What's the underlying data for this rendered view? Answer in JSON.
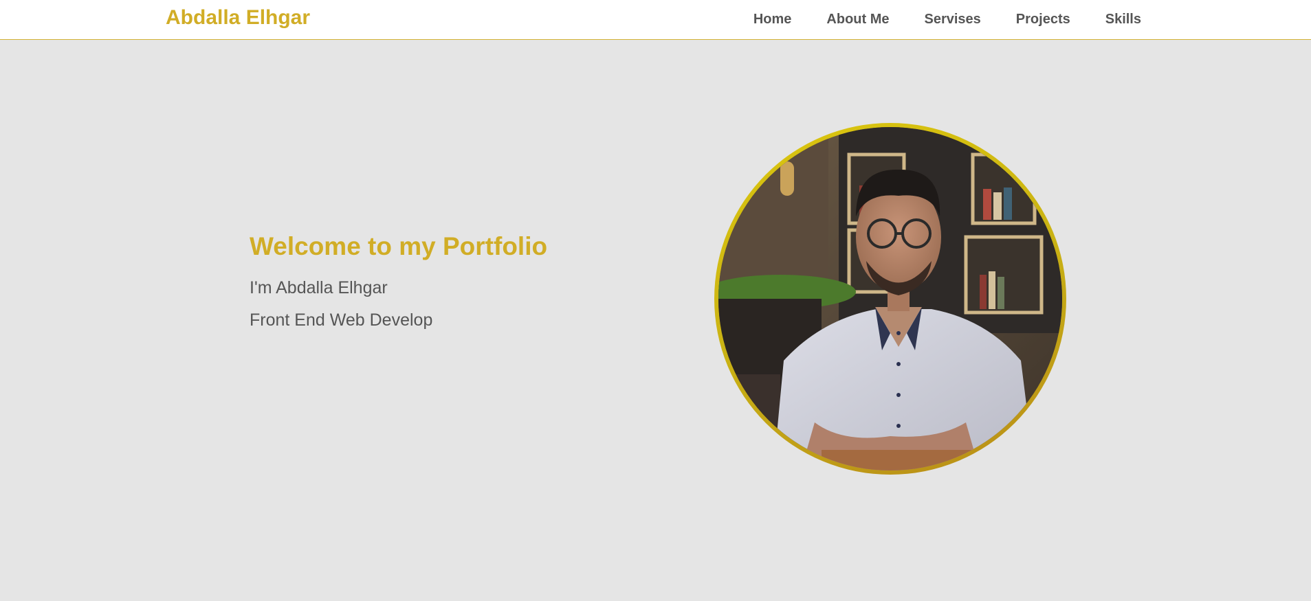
{
  "header": {
    "logo": "Abdalla Elhgar",
    "nav": [
      {
        "label": "Home"
      },
      {
        "label": "About Me"
      },
      {
        "label": "Servises"
      },
      {
        "label": "Projects"
      },
      {
        "label": "Skills"
      }
    ]
  },
  "hero": {
    "title": "Welcome to my Portfolio",
    "name_line": "I'm Abdalla Elhgar",
    "role_line": "Front End Web Develop"
  },
  "colors": {
    "accent": "#d1ad26",
    "nav_text": "#555555",
    "page_bg": "#e5e5e5",
    "header_bg": "#ffffff"
  }
}
